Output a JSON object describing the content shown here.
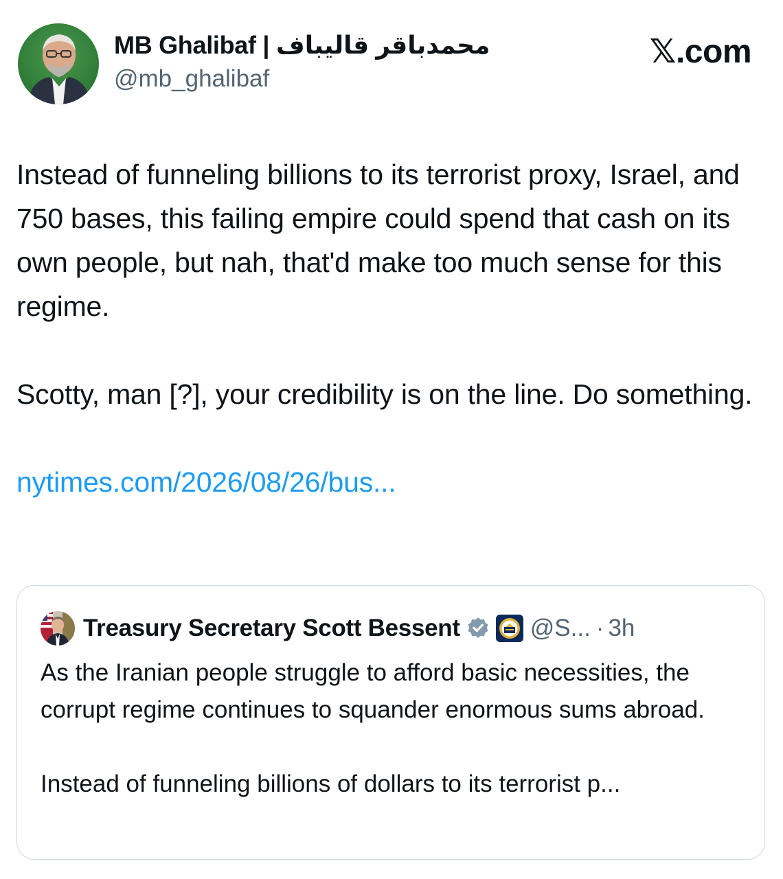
{
  "author": {
    "display_name": "MB Ghalibaf | محمدباقر قالیباف",
    "handle": "@mb_ghalibaf",
    "avatar_icon": "profile-photo"
  },
  "brand": "𝕏.com",
  "tweet": {
    "paragraph_1": "Instead of funneling billions to its terrorist proxy, Israel, and 750 bases, this failing empire could spend that cash on its own people, but nah, that'd make too much sense for this regime.",
    "paragraph_2": "Scotty, man [?], your credibility is on the line. Do something.",
    "link_text": "nytimes.com/2026/08/26/bus..."
  },
  "quoted_tweet": {
    "display_name": "Treasury Secretary Scott Bessent",
    "verified_icon": "verified-badge-gray",
    "affiliate_icon": "treasury-seal",
    "handle": "@S...",
    "separator": "·",
    "time": "3h",
    "paragraph_1": "As the Iranian people struggle to afford basic necessities, the corrupt regime continues to squander enormous sums abroad.",
    "paragraph_2": "Instead of funneling billions of dollars to its terrorist p..."
  },
  "colors": {
    "text": "#0f1419",
    "secondary": "#536471",
    "link": "#1d9bf0",
    "border": "#cfd9de"
  }
}
